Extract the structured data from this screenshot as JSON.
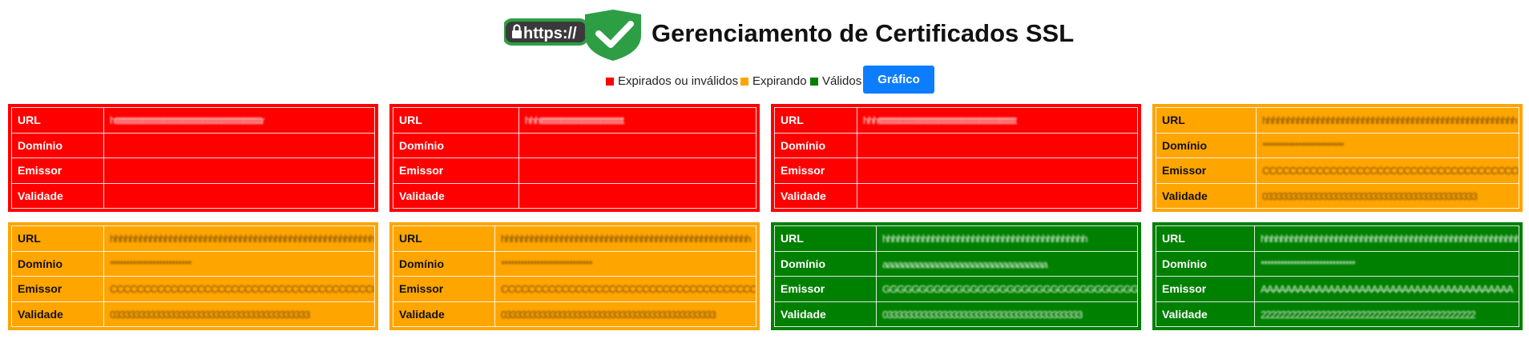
{
  "header": {
    "logo_text": "https://",
    "title": "Gerenciamento de Certificados SSL"
  },
  "legend": {
    "expired_label": "Expirados ou inválidos",
    "expiring_label": "Expirando",
    "valid_label": "Válidos",
    "chart_button": "Gráfico"
  },
  "colors": {
    "expired": "#ff0000",
    "expiring": "#ffa500",
    "valid": "#008000",
    "button": "#0d7dff"
  },
  "field_labels": {
    "url": "URL",
    "domain": "Domínio",
    "issuer": "Emissor",
    "validity": "Validade"
  },
  "cards": [
    {
      "status": "expired",
      "url": "httttttttttttttttttttttttttttttttttttttttttttttttttttttttttttttttttttttr",
      "domain": "",
      "issuer": "",
      "validity": ""
    },
    {
      "status": "expired",
      "url": "hhhtttttttttttttttttttttttttttttttttttttttt",
      "domain": "",
      "issuer": "",
      "validity": ""
    },
    {
      "status": "expired",
      "url": "hhhtttttttttttttttttttttttttttttttttttttttttttttttttttttttttttttttttt",
      "domain": "",
      "issuer": "",
      "validity": ""
    },
    {
      "status": "expiring",
      "url": "hhhhhhhhhhhhhhhhhhhhhhhhhhhhhhhhhhhhhhhhhhhhhhhhhhh",
      "domain": "*************************",
      "issuer": "CCCCCCCCCCCCCCCCCCCCCCCCCCCCCCCCCCCCCCCCCCCCCCCCCCCCCCCC",
      "validity": "0333333333333333333333333333333333333333333"
    },
    {
      "status": "expiring",
      "url": "hhhhhhhhhhhhhhhhhhhhhhhhhhhhhhhhhhhhhhhhhhhhhhhhhhhhhhhhhhhhhhh",
      "domain": "*************************",
      "issuer": "CCCCCCCCCCCCCCCCCCCCCCCCCCCCCCCCCCCCCCCCCCCCCCCCC",
      "validity": "0333333333333333333333333333333333333333"
    },
    {
      "status": "expiring",
      "url": "hhhhhhhhhhhhhhhhhhhhhhhhhhhhhhhhhhhhhhhhhhhhhhhhhh",
      "domain": "****************************",
      "issuer": "CCCCCCCCCCCCCCCCCCCCCCCCCCCCCCCCCCCCCCCCCCCCCCCCCC",
      "validity": "0333333333333333333333333333333333333333333"
    },
    {
      "status": "valid",
      "url": "hhhhhhhhhhhhhhhhhhhhhhhhhhhhhhhhhhhhhhhhh",
      "domain": "aaaaaaaaaaaaaaaaaaaaaaaaaaaaaaaaa",
      "issuer": "GGGGGGGGGGGGGGGGGGGGGGGGGGGGGGGGGGGGGGG",
      "validity": "0333333333333333333333333333333333333333"
    },
    {
      "status": "valid",
      "url": "hhhhhhhhhhhhhhhhhhhhhhhhhhhhhhhhhhhhhhhhhhhhhhhhhhhhhhhhhhh",
      "domain": "*****************************",
      "issuer": "AAAAAAAAAAAAAAAAAAAAAAAAAAAAAAAAAAAAAAAAA",
      "validity": "2222222222222222222222222222222222222222222"
    }
  ]
}
